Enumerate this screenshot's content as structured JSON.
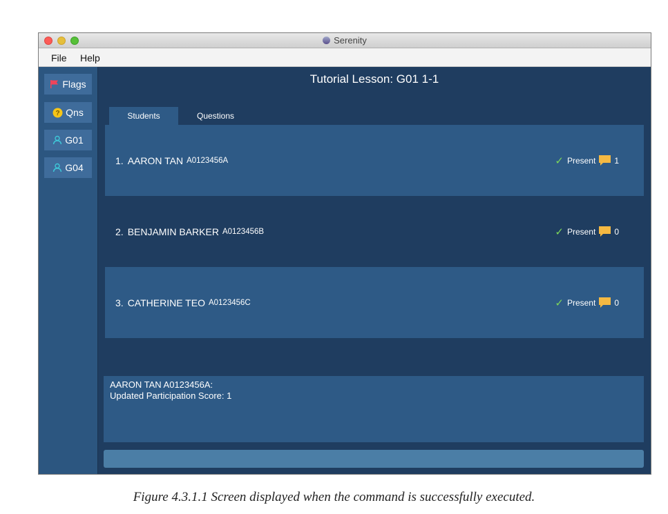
{
  "window": {
    "title": "Serenity"
  },
  "menu": {
    "items": [
      "File",
      "Help"
    ]
  },
  "sidebar": {
    "items": [
      {
        "label": "Flags",
        "icon": "flag-icon"
      },
      {
        "label": "Qns",
        "icon": "question-icon"
      },
      {
        "label": "G01",
        "icon": "user-icon"
      },
      {
        "label": "G04",
        "icon": "user-icon"
      }
    ]
  },
  "main": {
    "title": "Tutorial Lesson: G01 1-1",
    "tabs": [
      {
        "label": "Students",
        "active": true
      },
      {
        "label": "Questions",
        "active": false
      }
    ],
    "students": [
      {
        "index": "1.",
        "name": "AARON TAN",
        "matric": "A0123456A",
        "status": "Present",
        "score": "1"
      },
      {
        "index": "2.",
        "name": "BENJAMIN BARKER",
        "matric": "A0123456B",
        "status": "Present",
        "score": "0"
      },
      {
        "index": "3.",
        "name": "CATHERINE TEO",
        "matric": "A0123456C",
        "status": "Present",
        "score": "0"
      }
    ],
    "result": {
      "line1": "AARON TAN A0123456A:",
      "line2": "Updated Participation Score: 1"
    },
    "command_input": {
      "value": ""
    }
  },
  "caption": "Figure 4.3.1.1 Screen displayed when the command is successfully executed.",
  "colors": {
    "background": "#1f3d60",
    "sidebar": "#2c5680",
    "card": "#2e5a86",
    "check": "#7dd65a",
    "bubble": "#f5b942",
    "flag": "#f0445a"
  }
}
